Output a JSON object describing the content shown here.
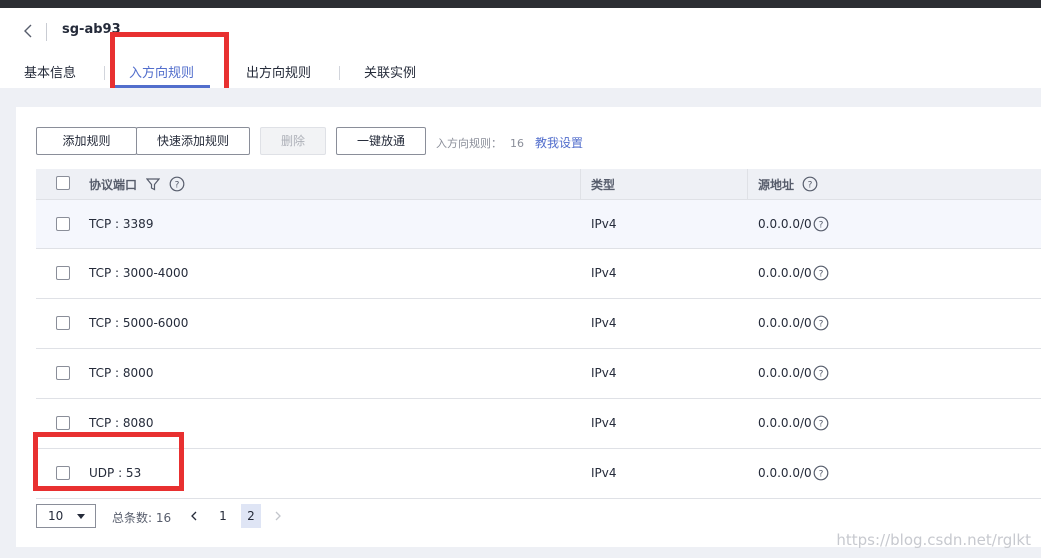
{
  "header": {
    "sg_name": "sg-ab93"
  },
  "tabs": [
    {
      "label": "基本信息",
      "active": false
    },
    {
      "label": "入方向规则",
      "active": true
    },
    {
      "label": "出方向规则",
      "active": false
    },
    {
      "label": "关联实例",
      "active": false
    }
  ],
  "toolbar": {
    "add_rule": "添加规则",
    "quick_add_rule": "快速添加规则",
    "delete": "删除",
    "one_click_allow": "一键放通",
    "rule_count_label": "入方向规则：",
    "rule_count_value": "16",
    "help_link": "教我设置"
  },
  "table": {
    "columns": [
      "协议端口",
      "类型",
      "源地址"
    ],
    "rows": [
      {
        "protocol_port": "TCP : 3389",
        "type": "IPv4",
        "source": "0.0.0.0/0"
      },
      {
        "protocol_port": "TCP : 3000-4000",
        "type": "IPv4",
        "source": "0.0.0.0/0"
      },
      {
        "protocol_port": "TCP : 5000-6000",
        "type": "IPv4",
        "source": "0.0.0.0/0"
      },
      {
        "protocol_port": "TCP : 8000",
        "type": "IPv4",
        "source": "0.0.0.0/0"
      },
      {
        "protocol_port": "TCP : 8080",
        "type": "IPv4",
        "source": "0.0.0.0/0"
      },
      {
        "protocol_port": "UDP : 53",
        "type": "IPv4",
        "source": "0.0.0.0/0"
      }
    ]
  },
  "pagination": {
    "page_size": "10",
    "total_label": "总条数: 16",
    "pages": [
      "1",
      "2"
    ],
    "current_page": "2"
  },
  "watermark": "https://blog.csdn.net/rglkt",
  "colors": {
    "accent": "#526ecc",
    "highlight_box": "#e83030",
    "topbar": "#2c2e33"
  },
  "icons": {
    "back": "chevron-left-icon",
    "filter": "filter-icon",
    "help": "question-circle-icon",
    "prev": "chevron-left-icon",
    "next": "chevron-right-icon"
  }
}
